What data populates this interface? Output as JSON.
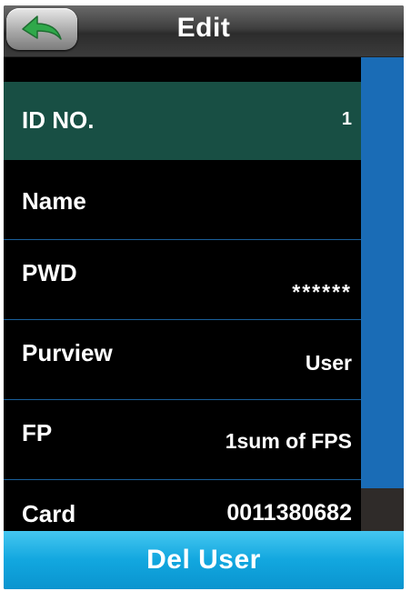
{
  "header": {
    "title": "Edit",
    "back_icon": "back-arrow-icon"
  },
  "fields": [
    {
      "label": "ID NO.",
      "value": "1"
    },
    {
      "label": "Name",
      "value": ""
    },
    {
      "label": "PWD",
      "value": "******"
    },
    {
      "label": "Purview",
      "value": "User"
    },
    {
      "label": "FP",
      "value": "1sum of FPS"
    },
    {
      "label": "Card",
      "value": "0011380682"
    }
  ],
  "footer": {
    "del_label": "Del User"
  },
  "colors": {
    "selected_row": "#184f44",
    "scroll_thumb": "#1a6cb6",
    "button": "#12a7df",
    "back_arrow": "#2fa84a"
  }
}
